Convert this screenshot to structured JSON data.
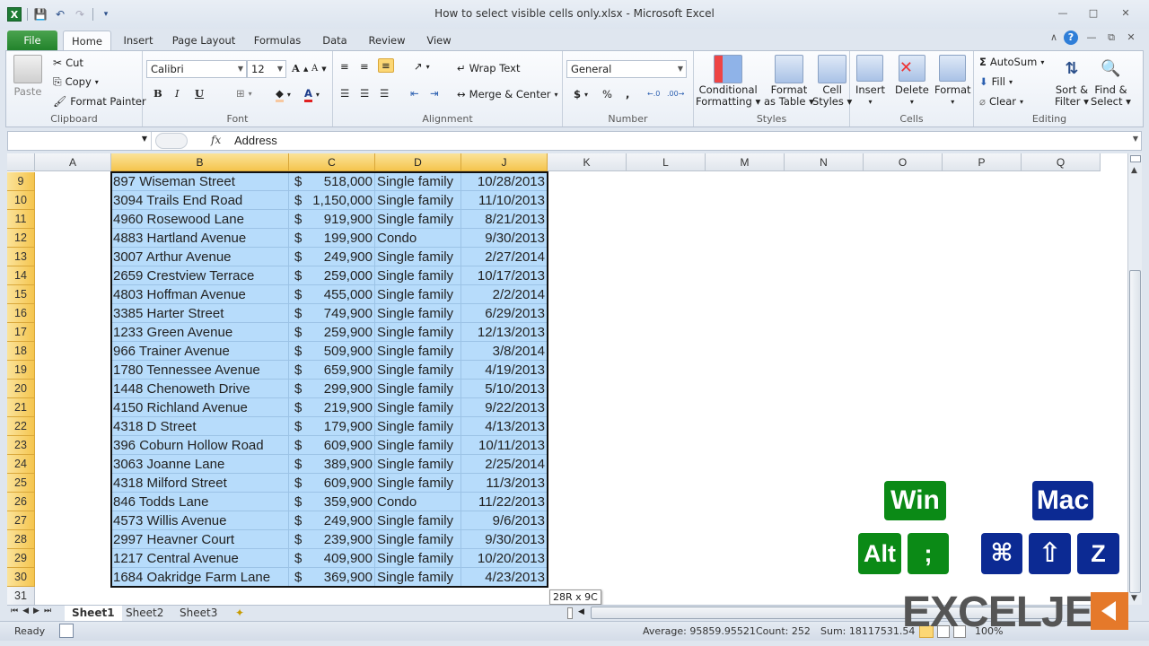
{
  "window": {
    "title": "How to select visible cells only.xlsx - Microsoft Excel",
    "controls": [
      "minimize",
      "restore",
      "close"
    ]
  },
  "qat": {
    "icons": [
      "excel-logo",
      "save-icon",
      "undo-icon",
      "redo-icon",
      "customize-qat-icon"
    ]
  },
  "tabs": [
    {
      "label": "File"
    },
    {
      "label": "Home",
      "active": true
    },
    {
      "label": "Insert"
    },
    {
      "label": "Page Layout"
    },
    {
      "label": "Formulas"
    },
    {
      "label": "Data"
    },
    {
      "label": "Review"
    },
    {
      "label": "View"
    }
  ],
  "ribbon": {
    "clipboard": {
      "label": "Clipboard",
      "paste": "Paste",
      "cut": "Cut",
      "copy": "Copy",
      "format_painter": "Format Painter"
    },
    "font": {
      "label": "Font",
      "font_name": "Calibri",
      "font_size": "12",
      "bold": "B",
      "italic": "I",
      "underline": "U"
    },
    "alignment": {
      "label": "Alignment",
      "wrap_text": "Wrap Text",
      "merge_center": "Merge & Center"
    },
    "number": {
      "label": "Number",
      "format": "General",
      "currency": "$",
      "percent": "%",
      "comma": ","
    },
    "styles": {
      "label": "Styles",
      "conditional": [
        "Conditional",
        "Formatting"
      ],
      "format_table": [
        "Format",
        "as Table"
      ],
      "cell_styles": [
        "Cell",
        "Styles"
      ]
    },
    "cells": {
      "label": "Cells",
      "insert": "Insert",
      "delete": "Delete",
      "format": "Format"
    },
    "editing": {
      "label": "Editing",
      "autosum": "AutoSum",
      "fill": "Fill",
      "clear": "Clear",
      "sort_filter": [
        "Sort &",
        "Filter"
      ],
      "find_select": [
        "Find &",
        "Select"
      ]
    }
  },
  "formula_bar": {
    "name_box": "",
    "fx": "fx",
    "content": "Address"
  },
  "columns": [
    {
      "label": "A",
      "selected": false
    },
    {
      "label": "B",
      "selected": true
    },
    {
      "label": "C",
      "selected": true
    },
    {
      "label": "D",
      "selected": true
    },
    {
      "label": "J",
      "selected": true
    },
    {
      "label": "K",
      "selected": false
    },
    {
      "label": "L",
      "selected": false
    },
    {
      "label": "M",
      "selected": false
    },
    {
      "label": "N",
      "selected": false
    },
    {
      "label": "O",
      "selected": false
    },
    {
      "label": "P",
      "selected": false
    },
    {
      "label": "Q",
      "selected": false
    }
  ],
  "rows": [
    {
      "num": "9",
      "address": "897 Wiseman Street",
      "currency": "$",
      "price": "518,000",
      "type": "Single family",
      "date": "10/28/2013"
    },
    {
      "num": "10",
      "address": "3094 Trails End Road",
      "currency": "$",
      "price": "1,150,000",
      "type": "Single family",
      "date": "11/10/2013"
    },
    {
      "num": "11",
      "address": "4960 Rosewood Lane",
      "currency": "$",
      "price": "919,900",
      "type": "Single family",
      "date": "8/21/2013"
    },
    {
      "num": "12",
      "address": "4883 Hartland Avenue",
      "currency": "$",
      "price": "199,900",
      "type": "Condo",
      "date": "9/30/2013"
    },
    {
      "num": "13",
      "address": "3007 Arthur Avenue",
      "currency": "$",
      "price": "249,900",
      "type": "Single family",
      "date": "2/27/2014"
    },
    {
      "num": "14",
      "address": "2659 Crestview Terrace",
      "currency": "$",
      "price": "259,000",
      "type": "Single family",
      "date": "10/17/2013"
    },
    {
      "num": "15",
      "address": "4803 Hoffman Avenue",
      "currency": "$",
      "price": "455,000",
      "type": "Single family",
      "date": "2/2/2014"
    },
    {
      "num": "16",
      "address": "3385 Harter Street",
      "currency": "$",
      "price": "749,900",
      "type": "Single family",
      "date": "6/29/2013"
    },
    {
      "num": "17",
      "address": "1233 Green Avenue",
      "currency": "$",
      "price": "259,900",
      "type": "Single family",
      "date": "12/13/2013"
    },
    {
      "num": "18",
      "address": "966 Trainer Avenue",
      "currency": "$",
      "price": "509,900",
      "type": "Single family",
      "date": "3/8/2014"
    },
    {
      "num": "19",
      "address": "1780 Tennessee Avenue",
      "currency": "$",
      "price": "659,900",
      "type": "Single family",
      "date": "4/19/2013"
    },
    {
      "num": "20",
      "address": "1448 Chenoweth Drive",
      "currency": "$",
      "price": "299,900",
      "type": "Single family",
      "date": "5/10/2013"
    },
    {
      "num": "21",
      "address": "4150 Richland Avenue",
      "currency": "$",
      "price": "219,900",
      "type": "Single family",
      "date": "9/22/2013"
    },
    {
      "num": "22",
      "address": "4318 D Street",
      "currency": "$",
      "price": "179,900",
      "type": "Single family",
      "date": "4/13/2013"
    },
    {
      "num": "23",
      "address": "396 Coburn Hollow Road",
      "currency": "$",
      "price": "609,900",
      "type": "Single family",
      "date": "10/11/2013"
    },
    {
      "num": "24",
      "address": "3063 Joanne Lane",
      "currency": "$",
      "price": "389,900",
      "type": "Single family",
      "date": "2/25/2014"
    },
    {
      "num": "25",
      "address": "4318 Milford Street",
      "currency": "$",
      "price": "609,900",
      "type": "Single family",
      "date": "11/3/2013"
    },
    {
      "num": "26",
      "address": "846 Todds Lane",
      "currency": "$",
      "price": "359,900",
      "type": "Condo",
      "date": "11/22/2013"
    },
    {
      "num": "27",
      "address": "4573 Willis Avenue",
      "currency": "$",
      "price": "249,900",
      "type": "Single family",
      "date": "9/6/2013"
    },
    {
      "num": "28",
      "address": "2997 Heavner Court",
      "currency": "$",
      "price": "239,900",
      "type": "Single family",
      "date": "9/30/2013"
    },
    {
      "num": "29",
      "address": "1217 Central Avenue",
      "currency": "$",
      "price": "409,900",
      "type": "Single family",
      "date": "10/20/2013"
    },
    {
      "num": "30",
      "address": "1684 Oakridge Farm Lane",
      "currency": "$",
      "price": "369,900",
      "type": "Single family",
      "date": "4/23/2013"
    }
  ],
  "extra_row": "31",
  "selection_tooltip": "28R x 9C",
  "sheets": [
    {
      "label": "Sheet1",
      "active": true
    },
    {
      "label": "Sheet2"
    },
    {
      "label": "Sheet3"
    }
  ],
  "status": {
    "ready": "Ready",
    "average": "Average: 95859.95521",
    "count": "Count: 252",
    "sum": "Sum: 18117531.54",
    "zoom": "100%"
  },
  "shortcuts": {
    "win_label": "Win",
    "win_keys": [
      "Alt",
      ";"
    ],
    "mac_label": "Mac",
    "mac_keys": [
      "⌘",
      "⇧",
      "Z"
    ],
    "win_color": "#0b8a16",
    "mac_color": "#0c2a93"
  },
  "watermark": "EXCELJET",
  "colors": {
    "selection_fill": "#b7dcfb",
    "header_selected": "#f5c54e",
    "file_tab": "#22832b",
    "brand_orange": "#e5792a"
  }
}
